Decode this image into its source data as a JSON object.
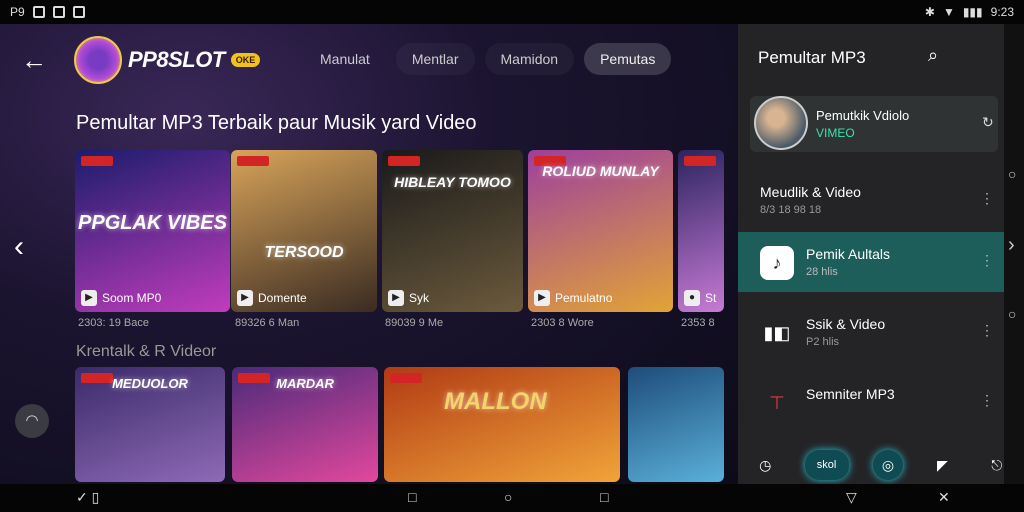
{
  "status": {
    "left_text": "P9",
    "time": "9:23"
  },
  "header": {
    "logo_text": "PP8SLOT",
    "logo_badge": "OKE",
    "tabs": [
      {
        "label": "Manulat"
      },
      {
        "label": "Mentlar"
      },
      {
        "label": "Mamidon"
      },
      {
        "label": "Pemutas"
      }
    ]
  },
  "headline": "Pemultar MP3 Terbaik paur Musik yard Video",
  "subhead": "Krentalk & R Videor",
  "row1": [
    {
      "title": "PPGLAK VIBES",
      "label": "Soom MP0",
      "meta": "2303: 19 Bace",
      "colors": [
        "#1b1d6b",
        "#c13cbd"
      ]
    },
    {
      "title": "TERSOOD",
      "label": "Domente",
      "meta": "89326 6 Man",
      "colors": [
        "#d8a45a",
        "#3a2b22"
      ]
    },
    {
      "title": "HIBLEAY TOMOO",
      "label": "Syk",
      "meta": "89039 9 Me",
      "colors": [
        "#1a1a1a",
        "#6b5a3c"
      ]
    },
    {
      "title": "ROLIUD MUNLAY",
      "label": "Pemulatno",
      "meta": "2303 8 Wore",
      "colors": [
        "#9d3f9e",
        "#e2a436"
      ]
    },
    {
      "title": "",
      "label": "St",
      "meta": "2353 8",
      "colors": [
        "#2b2460",
        "#c77ad4"
      ]
    }
  ],
  "row2": [
    {
      "title": "MEDUOLOR",
      "colors": [
        "#3b2a6a",
        "#8e6bb5"
      ]
    },
    {
      "title": "MARDAR",
      "colors": [
        "#4b2a7a",
        "#e2489d"
      ]
    },
    {
      "title": "MALLON",
      "colors": [
        "#b13a14",
        "#f1a43a"
      ]
    },
    {
      "title": "",
      "colors": [
        "#1e4c7a",
        "#5ab0da"
      ]
    }
  ],
  "sidebar": {
    "title": "Pemultar MP3",
    "account": {
      "name": "Pemutkik Vdiolo",
      "sub": "VIMEO"
    },
    "items": [
      {
        "label": "Meudlik & Video",
        "sub": "8/3 18 98 18",
        "icon": "none"
      },
      {
        "label": "Pemik Aultals",
        "sub": "28 hlis",
        "icon": "music-note-icon"
      },
      {
        "label": "Ssik & Video",
        "sub": "P2 hlis",
        "icon": "film-icon"
      },
      {
        "label": "Semniter MP3",
        "sub": "",
        "icon": "pin-icon"
      }
    ],
    "bottom_badge": "skol"
  },
  "colors": {
    "accent": "#1d5e5b",
    "brand_gold": "#f2c21c",
    "tag_red": "#d32525"
  }
}
